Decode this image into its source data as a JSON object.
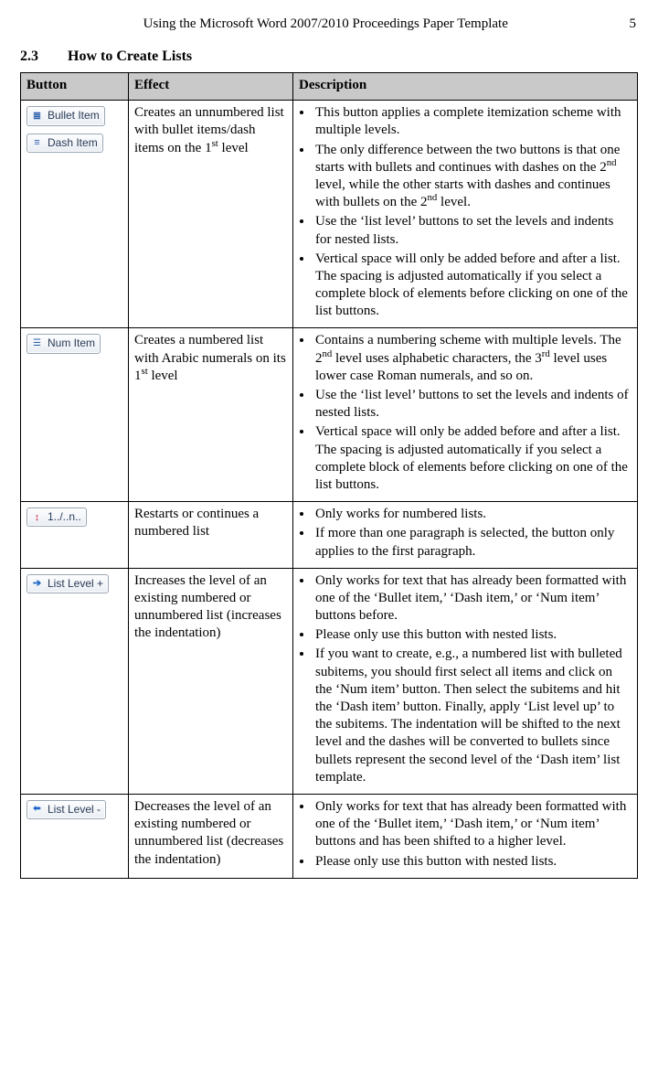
{
  "header": {
    "title": "Using the Microsoft Word 2007/2010 Proceedings Paper Template",
    "page_number": "5"
  },
  "section": {
    "number": "2.3",
    "title": "How to Create Lists"
  },
  "table": {
    "headers": {
      "button": "Button",
      "effect": "Effect",
      "description": "Description"
    },
    "rows": [
      {
        "buttons": [
          {
            "name": "bullet-item-button",
            "icon": "bullets-icon",
            "label": "Bullet Item"
          },
          {
            "name": "dash-item-button",
            "icon": "dashes-icon",
            "label": "Dash Item"
          }
        ],
        "effect_html": "Creates an unnumbered list with bullet items/dash items on the 1<sup>st</sup> level",
        "description_html": [
          "This button applies a complete itemization scheme with multiple levels.",
          "The only difference between the two buttons is that one starts with bullets and continues with dashes on the 2<sup>nd</sup> level, while the other starts with dashes and continues with bullets on the 2<sup>nd</sup> level.",
          "Use the ‘list level’ buttons to set the levels and indents for nested lists.",
          "Vertical space will only be added before and after a list. The spacing is adjusted automati&shy;cally if you select a complete block of elements before clicking on one of the list buttons."
        ]
      },
      {
        "buttons": [
          {
            "name": "num-item-button",
            "icon": "num-icon",
            "label": "Num Item"
          }
        ],
        "effect_html": "Creates a numbered list with Arabic numerals on its 1<sup>st</sup> level",
        "description_html": [
          "Contains a numbering scheme with multiple levels. The 2<sup>nd</sup> level uses alphabetic charac&shy;ters, the 3<sup>rd</sup> level uses lower case Roman numerals, and so on.",
          "Use the ‘list level’ buttons to set the levels and indents of nested lists.",
          "Vertical space will only be added before and after a list. The spacing is adjusted automati&shy;cally if you select a complete block of elements before clicking on one of the list buttons."
        ]
      },
      {
        "buttons": [
          {
            "name": "restart-numbering-button",
            "icon": "restart-icon",
            "label": "1../..n.."
          }
        ],
        "effect_html": "Restarts or continues a numbered list",
        "description_html": [
          "Only works for numbered lists.",
          "If more than one paragraph is selected, the button only applies to the first paragraph."
        ]
      },
      {
        "buttons": [
          {
            "name": "list-level-up-button",
            "icon": "level-up-icon",
            "label": "List Level +"
          }
        ],
        "effect_html": "Increases the level of an existing numbered or unnumbered list (increases the indentation)",
        "description_html": [
          "Only works for text that has already been formatted with one of the ‘Bullet item,’ ‘Dash item,’ or ‘Num item’ buttons before.",
          "Please only use this button with nested lists.",
          "If you want to create, e.g., a numbered list with bulleted subitems, you should first select all items and click on the ‘Num item’ button. Then select the subitems and hit the ‘Dash item’ button. Finally, apply ‘List level up’ to the subitems. The indentation will be shifted to the next level and the dashes will be con&shy;verted to bullets since bullets represent the second level of the ‘Dash item’ list template."
        ]
      },
      {
        "buttons": [
          {
            "name": "list-level-down-button",
            "icon": "level-down-icon",
            "label": "List Level -"
          }
        ],
        "effect_html": "Decreases the level of an existing numbered or unnumbered list (decreases the indentation)",
        "description_html": [
          "Only works for text that has already been formatted with one of the ‘Bullet item,’ ‘Dash item,’ or ‘Num item’ buttons and has been shifted to a higher level.",
          "Please only use this button with nested lists."
        ]
      }
    ]
  }
}
